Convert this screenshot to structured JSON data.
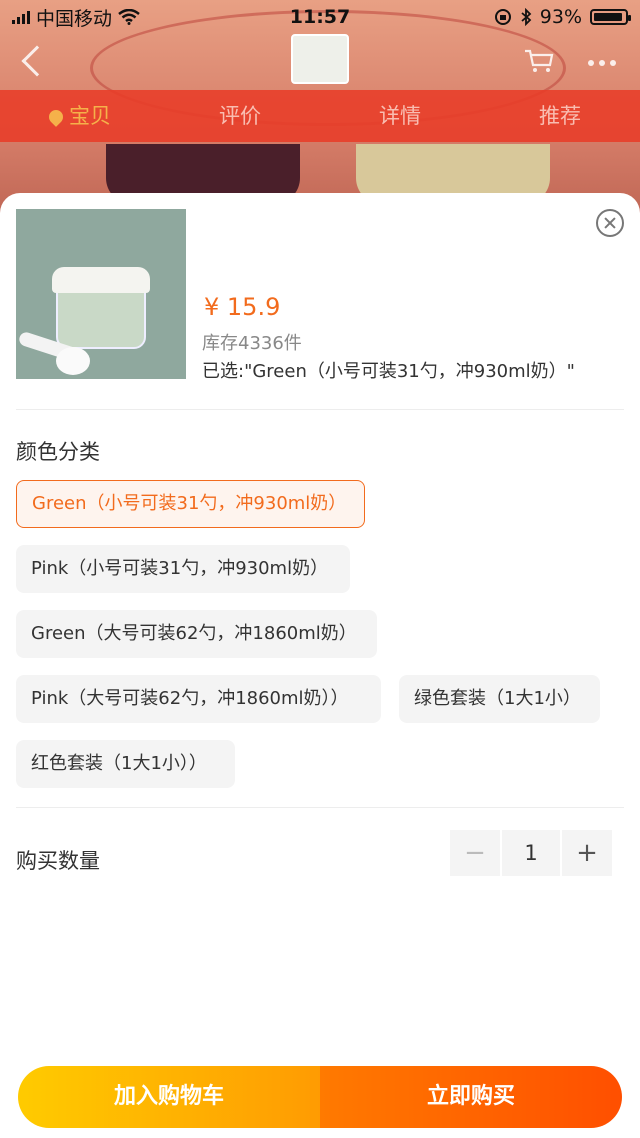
{
  "status_bar": {
    "carrier": "中国移动",
    "time": "11:57",
    "battery": "93%",
    "battery_level": 0.93
  },
  "tabs": [
    {
      "label": "宝贝",
      "active": true
    },
    {
      "label": "评价",
      "active": false
    },
    {
      "label": "详情",
      "active": false
    },
    {
      "label": "推荐",
      "active": false
    }
  ],
  "product": {
    "price": "¥ 15.9",
    "stock": "库存4336件",
    "selected": "已选:\"Green（小号可装31勺，冲930ml奶）\""
  },
  "color_section": {
    "title": "颜色分类",
    "options": [
      {
        "label": "Green（小号可装31勺，冲930ml奶）",
        "selected": true
      },
      {
        "label": "Pink（小号可装31勺，冲930ml奶）",
        "selected": false
      },
      {
        "label": "Green（大号可装62勺，冲1860ml奶）",
        "selected": false
      },
      {
        "label": "Pink（大号可装62勺，冲1860ml奶））",
        "selected": false
      },
      {
        "label": "绿色套装（1大1小）",
        "selected": false
      },
      {
        "label": "红色套装（1大1小））",
        "selected": false
      }
    ]
  },
  "quantity": {
    "label": "购买数量",
    "minus": "−",
    "value": "1",
    "plus": "+"
  },
  "actions": {
    "add_to_cart": "加入购物车",
    "buy_now": "立即购买"
  },
  "colors": {
    "accent": "#f26b1d",
    "cart_button": "#ffb400",
    "buy_button": "#ff6000",
    "tab_active": "#f5b14a"
  },
  "icons": [
    "signal-icon",
    "wifi-icon",
    "bluetooth-icon",
    "battery-icon",
    "back-icon",
    "cart-icon",
    "more-icon",
    "location-pin-icon",
    "close-icon"
  ]
}
